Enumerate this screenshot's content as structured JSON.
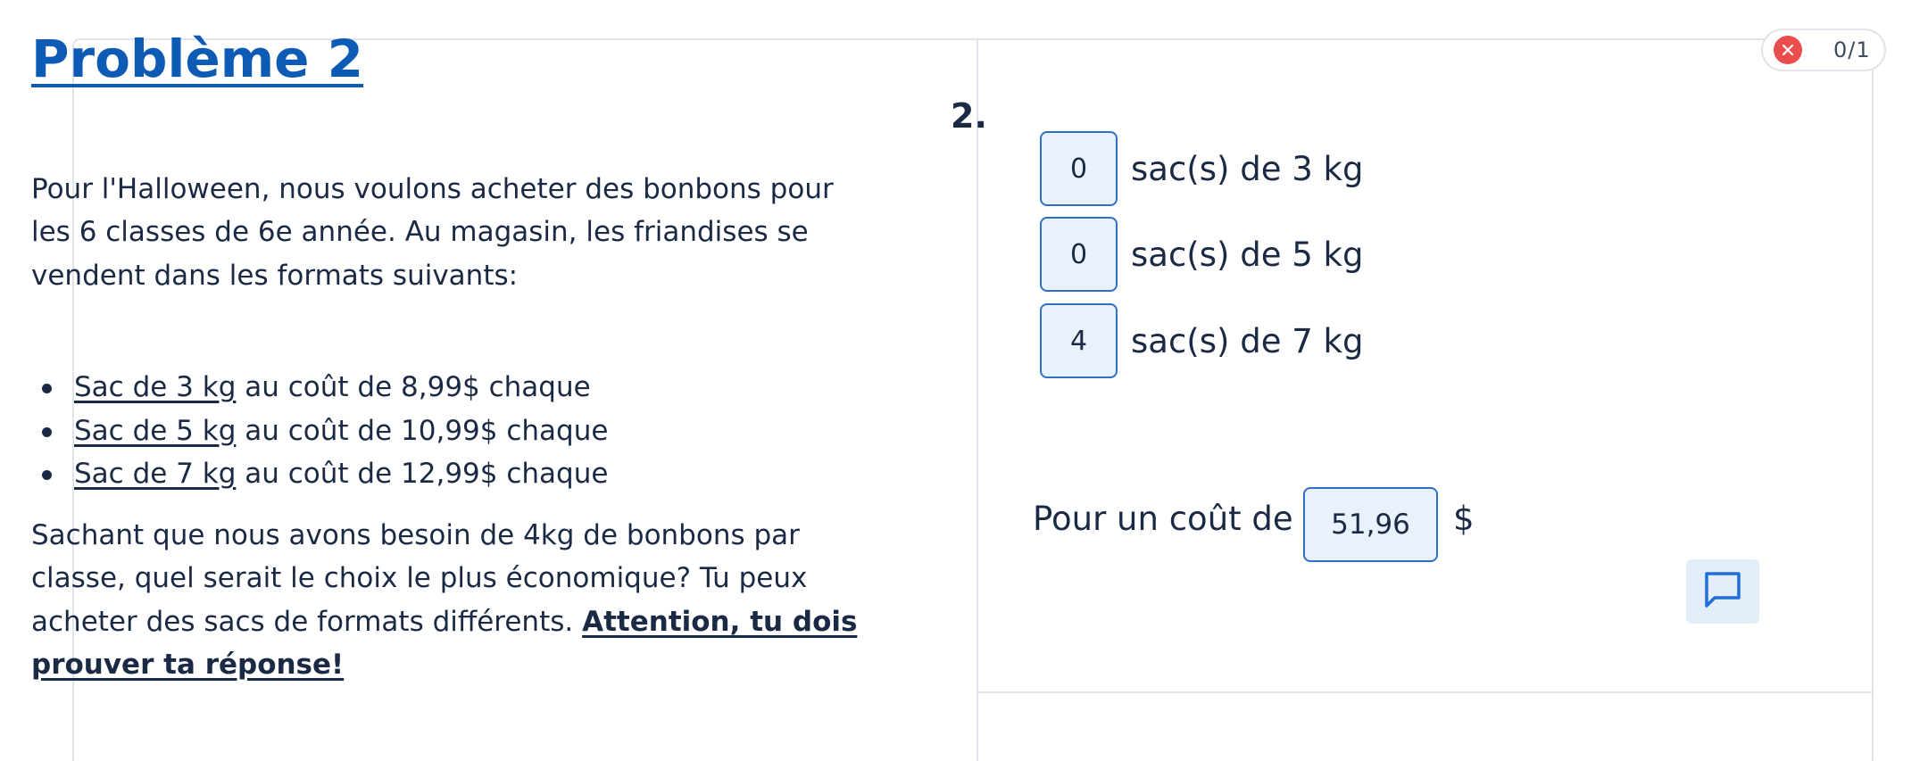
{
  "problem": {
    "title": "Problème 2",
    "intro": "Pour l'Halloween, nous voulons acheter des bonbons pour les 6 classes de 6e année. Au magasin, les friandises se vendent dans les formats suivants:",
    "items": [
      {
        "name": "Sac de 3 kg",
        "desc": " au coût de 8,99$ chaque"
      },
      {
        "name": "Sac de 5 kg",
        "desc": " au coût de 10,99$ chaque"
      },
      {
        "name": "Sac de 7 kg",
        "desc": " au coût de 12,99$ chaque"
      }
    ],
    "question": "Sachant que nous avons besoin de 4kg de bonbons par classe, quel serait le choix le plus économique? Tu peux acheter des sacs de formats différents. ",
    "warning": "Attention, tu dois prouver ta réponse!"
  },
  "answer": {
    "number": "2.",
    "rows": [
      {
        "value": "0",
        "label": "sac(s) de 3 kg"
      },
      {
        "value": "0",
        "label": "sac(s) de 5 kg"
      },
      {
        "value": "4",
        "label": "sac(s) de 7 kg"
      }
    ],
    "cost_label": "Pour un coût de :",
    "cost_value": "51,96",
    "cost_unit": "$"
  },
  "score": {
    "text": "0/1",
    "status_icon": "close-icon",
    "status_color": "#ea4d4d"
  },
  "comment": {
    "icon": "comment-icon"
  }
}
